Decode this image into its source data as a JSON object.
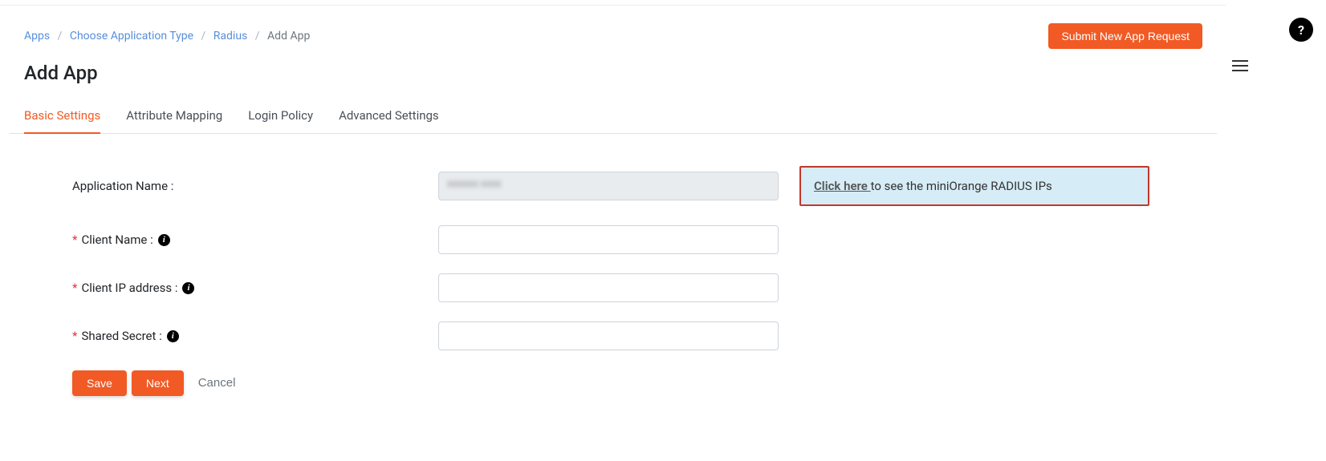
{
  "breadcrumb": {
    "items": [
      {
        "label": "Apps"
      },
      {
        "label": "Choose Application Type"
      },
      {
        "label": "Radius"
      }
    ],
    "current": "Add App"
  },
  "topbar": {
    "submit_label": "Submit New App Request"
  },
  "page": {
    "title": "Add App"
  },
  "tabs": [
    {
      "label": "Basic Settings",
      "active": true
    },
    {
      "label": "Attribute Mapping"
    },
    {
      "label": "Login Policy"
    },
    {
      "label": "Advanced Settings"
    }
  ],
  "form": {
    "app_name": {
      "label": "Application Name :",
      "value": ""
    },
    "client_name": {
      "label": "Client Name :"
    },
    "client_ip": {
      "label": "Client IP address :"
    },
    "shared_secret": {
      "label": "Shared Secret :"
    }
  },
  "callout": {
    "link_text": "Click here ",
    "rest_text": "to see the miniOrange RADIUS IPs"
  },
  "actions": {
    "save": "Save",
    "next": "Next",
    "cancel": "Cancel"
  },
  "icons": {
    "help": "?",
    "info": "i"
  }
}
